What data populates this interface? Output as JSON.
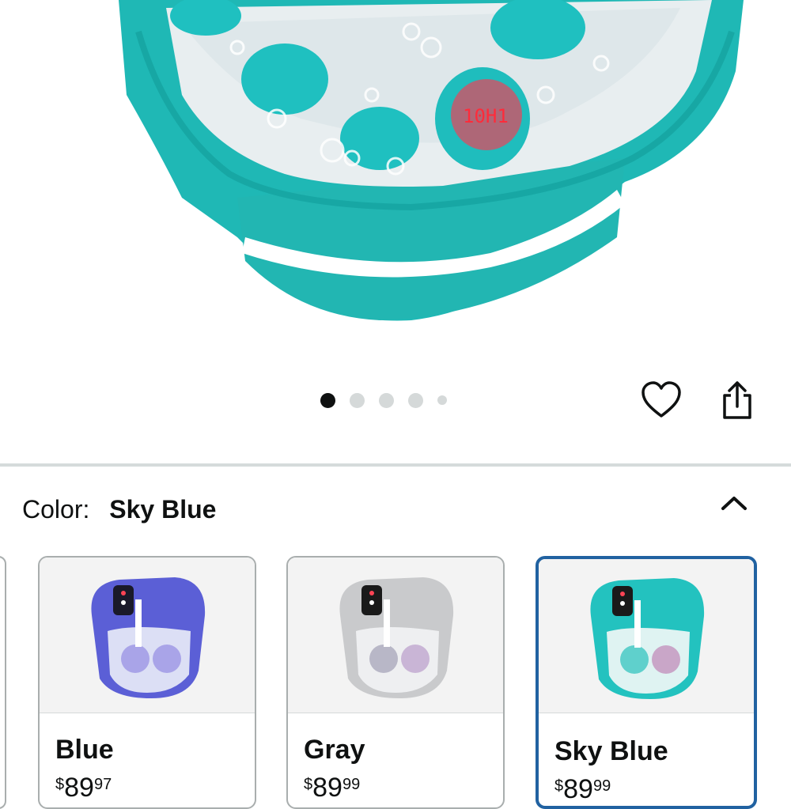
{
  "carousel": {
    "pages": 5,
    "active_index": 0
  },
  "color_selector": {
    "label": "Color:",
    "selected_value": "Sky Blue",
    "options": [
      {
        "name": "Blue",
        "price_symbol": "$",
        "price_whole": "89",
        "price_cents": "97",
        "swatch_color": "#5b5fd6"
      },
      {
        "name": "Gray",
        "price_symbol": "$",
        "price_whole": "89",
        "price_cents": "99",
        "swatch_color": "#c9cacc"
      },
      {
        "name": "Sky Blue",
        "price_symbol": "$",
        "price_whole": "89",
        "price_cents": "99",
        "swatch_color": "#23c2bf"
      }
    ]
  },
  "colors": {
    "product_teal": "#1fb8b5",
    "selected_border": "#2162a1",
    "divider": "#d5dbdb"
  },
  "icons": {
    "wishlist": "heart-icon",
    "share": "share-icon",
    "collapse": "chevron-up-icon"
  }
}
